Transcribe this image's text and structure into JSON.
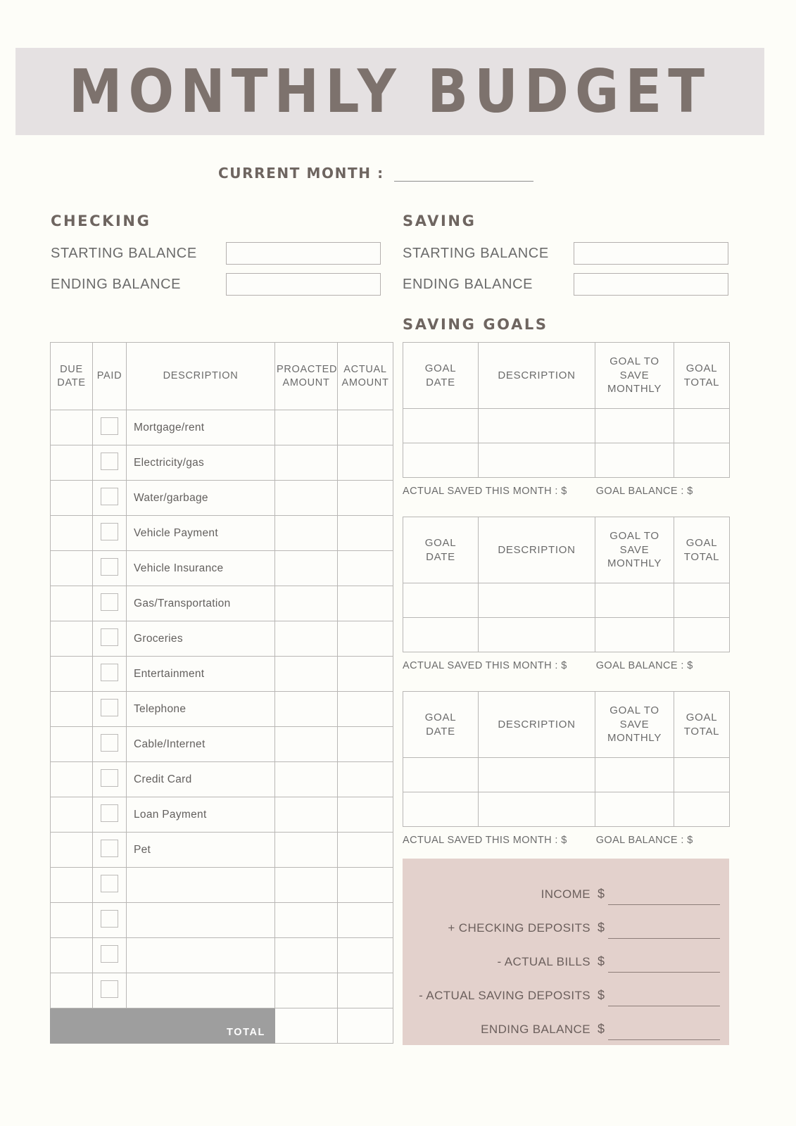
{
  "page": {
    "title": "MONTHLY BUDGET",
    "background_color": "#FDFDF8",
    "title_band_color": "#E5E1E2",
    "title_color": "#7D726D",
    "accent_pink": "#E3D1CC",
    "total_bar_color": "#9E9E9E",
    "border_color": "#B9B7B5"
  },
  "current_month": {
    "label": "CURRENT MONTH :",
    "value": ""
  },
  "checking": {
    "heading": "CHECKING",
    "starting_balance_label": "STARTING BALANCE",
    "starting_balance_value": "",
    "ending_balance_label": "ENDING BALANCE",
    "ending_balance_value": ""
  },
  "saving": {
    "heading": "SAVING",
    "starting_balance_label": "STARTING BALANCE",
    "starting_balance_value": "",
    "ending_balance_label": "ENDING BALANCE",
    "ending_balance_value": ""
  },
  "expense_table": {
    "columns": [
      "DUE DATE",
      "PAID",
      "DESCRIPTION",
      "PROACTED AMOUNT",
      "ACTUAL AMOUNT"
    ],
    "columns_lines": [
      [
        "DUE",
        "DATE"
      ],
      [
        "PAID"
      ],
      [
        "DESCRIPTION"
      ],
      [
        "PROACTED",
        "AMOUNT"
      ],
      [
        "ACTUAL",
        "AMOUNT"
      ]
    ],
    "rows": [
      {
        "due_date": "",
        "paid": false,
        "description": "Mortgage/rent",
        "projected": "",
        "actual": ""
      },
      {
        "due_date": "",
        "paid": false,
        "description": "Electricity/gas",
        "projected": "",
        "actual": ""
      },
      {
        "due_date": "",
        "paid": false,
        "description": "Water/garbage",
        "projected": "",
        "actual": ""
      },
      {
        "due_date": "",
        "paid": false,
        "description": "Vehicle Payment",
        "projected": "",
        "actual": ""
      },
      {
        "due_date": "",
        "paid": false,
        "description": "Vehicle Insurance",
        "projected": "",
        "actual": ""
      },
      {
        "due_date": "",
        "paid": false,
        "description": "Gas/Transportation",
        "projected": "",
        "actual": ""
      },
      {
        "due_date": "",
        "paid": false,
        "description": "Groceries",
        "projected": "",
        "actual": ""
      },
      {
        "due_date": "",
        "paid": false,
        "description": "Entertainment",
        "projected": "",
        "actual": ""
      },
      {
        "due_date": "",
        "paid": false,
        "description": "Telephone",
        "projected": "",
        "actual": ""
      },
      {
        "due_date": "",
        "paid": false,
        "description": "Cable/Internet",
        "projected": "",
        "actual": ""
      },
      {
        "due_date": "",
        "paid": false,
        "description": "Credit Card",
        "projected": "",
        "actual": ""
      },
      {
        "due_date": "",
        "paid": false,
        "description": "Loan Payment",
        "projected": "",
        "actual": ""
      },
      {
        "due_date": "",
        "paid": false,
        "description": "Pet",
        "projected": "",
        "actual": ""
      },
      {
        "due_date": "",
        "paid": false,
        "description": "",
        "projected": "",
        "actual": ""
      },
      {
        "due_date": "",
        "paid": false,
        "description": "",
        "projected": "",
        "actual": ""
      },
      {
        "due_date": "",
        "paid": false,
        "description": "",
        "projected": "",
        "actual": ""
      },
      {
        "due_date": "",
        "paid": false,
        "description": "",
        "projected": "",
        "actual": ""
      }
    ],
    "total_label": "TOTAL",
    "total_projected": "",
    "total_actual": ""
  },
  "saving_goals": {
    "heading": "SAVING GOALS",
    "columns_lines": [
      [
        "GOAL",
        "DATE"
      ],
      [
        "DESCRIPTION"
      ],
      [
        "GOAL TO",
        "SAVE",
        "MONTHLY"
      ],
      [
        "GOAL",
        "TOTAL"
      ]
    ],
    "tables": [
      {
        "rows": [
          {
            "goal_date": "",
            "description": "",
            "save_monthly": "",
            "goal_total": ""
          },
          {
            "goal_date": "",
            "description": "",
            "save_monthly": "",
            "goal_total": ""
          }
        ],
        "actual_saved_label": "ACTUAL SAVED THIS MONTH : $",
        "actual_saved_value": "",
        "goal_balance_label": "GOAL BALANCE : $",
        "goal_balance_value": ""
      },
      {
        "rows": [
          {
            "goal_date": "",
            "description": "",
            "save_monthly": "",
            "goal_total": ""
          },
          {
            "goal_date": "",
            "description": "",
            "save_monthly": "",
            "goal_total": ""
          }
        ],
        "actual_saved_label": "ACTUAL SAVED THIS MONTH : $",
        "actual_saved_value": "",
        "goal_balance_label": "GOAL BALANCE : $",
        "goal_balance_value": ""
      },
      {
        "rows": [
          {
            "goal_date": "",
            "description": "",
            "save_monthly": "",
            "goal_total": ""
          },
          {
            "goal_date": "",
            "description": "",
            "save_monthly": "",
            "goal_total": ""
          }
        ],
        "actual_saved_label": "ACTUAL SAVED THIS MONTH : $",
        "actual_saved_value": "",
        "goal_balance_label": "GOAL BALANCE : $",
        "goal_balance_value": ""
      }
    ]
  },
  "summary": {
    "rows": [
      {
        "label": "INCOME",
        "currency": "$",
        "value": ""
      },
      {
        "label": "+ CHECKING DEPOSITS",
        "currency": "$",
        "value": ""
      },
      {
        "label": "- ACTUAL BILLS",
        "currency": "$",
        "value": ""
      },
      {
        "label": "- ACTUAL SAVING DEPOSITS",
        "currency": "$",
        "value": ""
      },
      {
        "label": "ENDING BALANCE",
        "currency": "$",
        "value": ""
      }
    ]
  }
}
